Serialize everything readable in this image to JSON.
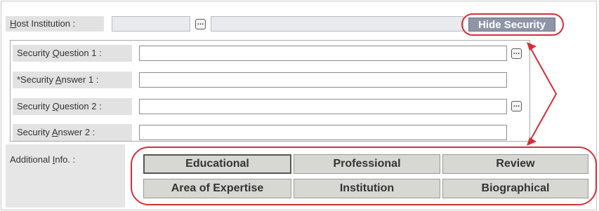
{
  "host_institution": {
    "label_prefix": "",
    "label_accel": "H",
    "label_rest": "ost Institution :",
    "field1_value": "",
    "field2_value": "",
    "lookup_icon": "ellipsis-icon",
    "hide_security_label": "Hide Security"
  },
  "security": {
    "rows": [
      {
        "pre": "Security ",
        "accel": "Q",
        "post": "uestion 1 :",
        "value": "",
        "has_lookup": true
      },
      {
        "pre": "*Security ",
        "accel": "A",
        "post": "nswer 1 :",
        "value": "",
        "has_lookup": false
      },
      {
        "pre": "Security ",
        "accel": "Q",
        "post": "uestion 2 :",
        "value": "",
        "has_lookup": true
      },
      {
        "pre": "Security ",
        "accel": "A",
        "post": "nswer 2 :",
        "value": "",
        "has_lookup": false
      }
    ]
  },
  "additional_info": {
    "label_pre": "Additional ",
    "label_accel": "I",
    "label_post": "nfo. :",
    "buttons": [
      {
        "label": "Educational"
      },
      {
        "label": "Professional"
      },
      {
        "label": "Review"
      },
      {
        "label": "Area of Expertise"
      },
      {
        "label": "Institution"
      },
      {
        "label": "Biographical"
      }
    ]
  },
  "colors": {
    "annotation": "#d62e3a",
    "label_bg": "#e2e2e2",
    "button_bg": "#d7d7d3"
  }
}
